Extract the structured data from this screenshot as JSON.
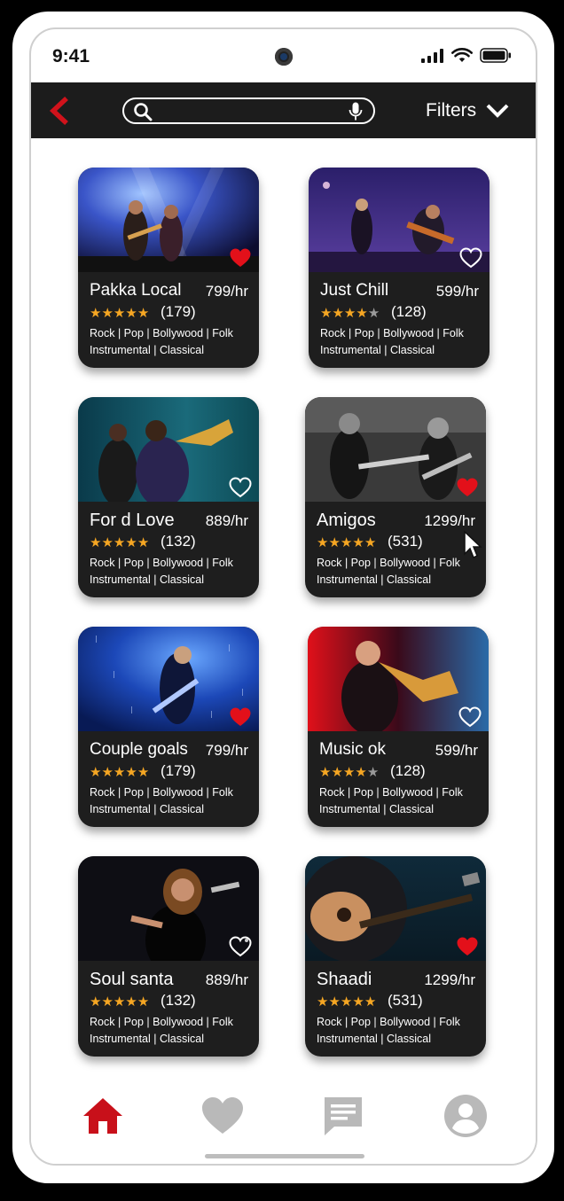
{
  "status": {
    "time": "9:41"
  },
  "header": {
    "search_placeholder": "",
    "filters_label": "Filters"
  },
  "icons": {
    "back": "chevron-left-icon",
    "search": "search-icon",
    "mic": "microphone-icon",
    "filters": "chevron-down-icon"
  },
  "colors": {
    "accent": "#c8101a",
    "star": "#f5a623",
    "card": "#1e1e1e",
    "topbar": "#1c1c1c",
    "nav_inactive": "#b9b9b9"
  },
  "cards": [
    {
      "name": "Pakka Local",
      "price": "799/hr",
      "rating": 5,
      "reviews": "(179)",
      "genres_line1": "Rock | Pop | Bollywood | Folk",
      "genres_line2": "Instrumental | Classical",
      "favorite": true
    },
    {
      "name": "Just Chill",
      "price": "599/hr",
      "rating": 4,
      "reviews": "(128)",
      "genres_line1": "Rock | Pop | Bollywood | Folk",
      "genres_line2": "Instrumental | Classical",
      "favorite": false
    },
    {
      "name": "For d Love",
      "price": "889/hr",
      "rating": 5,
      "reviews": "(132)",
      "genres_line1": "Rock | Pop | Bollywood | Folk",
      "genres_line2": "Instrumental | Classical",
      "favorite": false
    },
    {
      "name": "Amigos",
      "price": "1299/hr",
      "rating": 5,
      "reviews": "(531)",
      "genres_line1": "Rock | Pop | Bollywood | Folk",
      "genres_line2": "Instrumental | Classical",
      "favorite": true
    },
    {
      "name": "Couple goals",
      "price": "799/hr",
      "rating": 5,
      "reviews": "(179)",
      "genres_line1": "Rock | Pop | Bollywood | Folk",
      "genres_line2": "Instrumental | Classical",
      "favorite": true
    },
    {
      "name": "Music ok",
      "price": "599/hr",
      "rating": 4,
      "reviews": "(128)",
      "genres_line1": "Rock | Pop | Bollywood | Folk",
      "genres_line2": "Instrumental | Classical",
      "favorite": false
    },
    {
      "name": "Soul santa",
      "price": "889/hr",
      "rating": 5,
      "reviews": "(132)",
      "genres_line1": "Rock | Pop | Bollywood | Folk",
      "genres_line2": "Instrumental | Classical",
      "favorite": false
    },
    {
      "name": "Shaadi",
      "price": "1299/hr",
      "rating": 5,
      "reviews": "(531)",
      "genres_line1": "Rock | Pop | Bollywood | Folk",
      "genres_line2": "Instrumental | Classical",
      "favorite": true
    }
  ],
  "bottom_nav": [
    {
      "icon": "home-icon",
      "active": true
    },
    {
      "icon": "heart-icon",
      "active": false
    },
    {
      "icon": "chat-icon",
      "active": false
    },
    {
      "icon": "profile-icon",
      "active": false
    }
  ]
}
